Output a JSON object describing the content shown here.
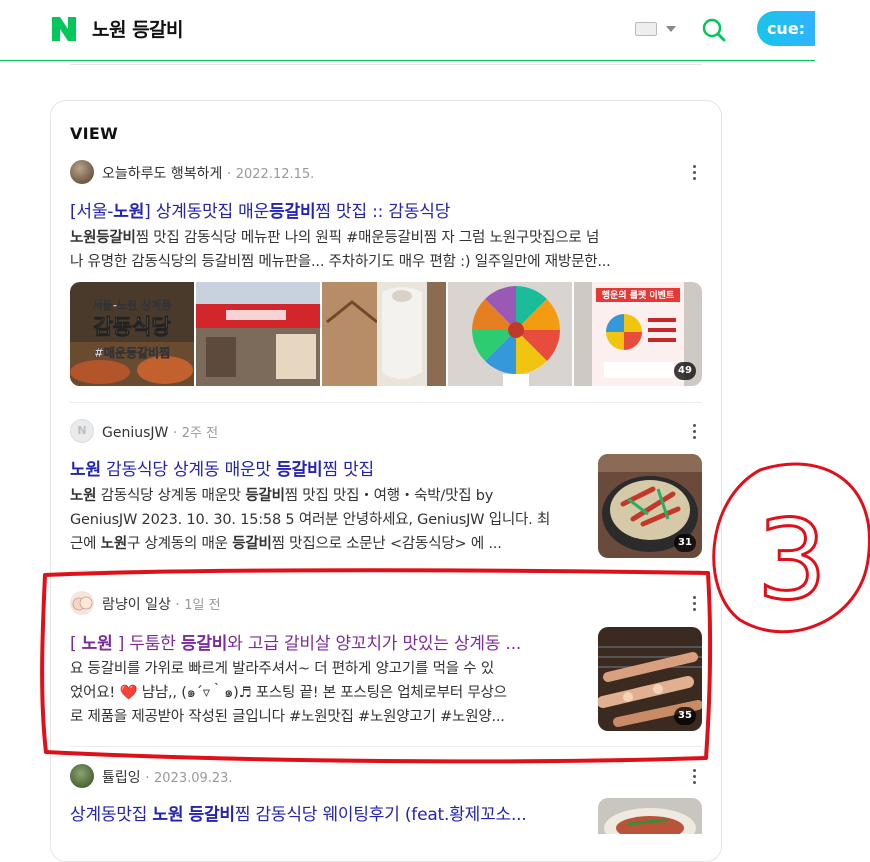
{
  "header": {
    "query": "노원 등갈비",
    "cue_label": "cue:"
  },
  "section": {
    "title": "VIEW"
  },
  "posts": [
    {
      "author": "오늘하루도 행복하게",
      "date": "2022.12.15.",
      "title_parts": [
        "[서울-",
        "노원",
        "] 상계동맛집 매운",
        "등갈비",
        "찜 맛집 :: 감동식당"
      ],
      "desc_line1_parts": [
        "노원등갈비",
        "찜 맛집 감동식당 메뉴판 나의 원픽 #매운등갈비찜 자 그럼 노원구맛집으로 넘"
      ],
      "desc_line2": "나 유명한 감동식당의 등갈비찜 메뉴판을... 주차하기도 매우 편함 :) 일주일만에 재방문한...",
      "thumb1_lines": [
        "서울-노원 상계동",
        "감동식당",
        "#매운등갈비찜"
      ],
      "thumb6_sign": "행운의 룰렛 이벤트",
      "image_count": "49"
    },
    {
      "author": "GeniusJW",
      "date": "2주 전",
      "title_parts": [
        "노원",
        " 감동식당 상계동 매운맛 ",
        "등갈비",
        "찜 맛집"
      ],
      "desc_line1_parts": [
        "노원",
        " 감동식당 상계동 매운맛 ",
        "등갈비",
        "찜 맛집 맛집・여행・숙박/맛집 by"
      ],
      "desc_line2": "GeniusJW 2023. 10. 30. 15:58 5 여러분 안녕하세요, GeniusJW 입니다. 최",
      "desc_line3_parts": [
        "근에 ",
        "노원",
        "구 상계동의 매운 ",
        "등갈비",
        "찜 맛집으로 소문난 <감동식당> 에 ..."
      ],
      "image_count": "31"
    },
    {
      "author": "람냥이 일상",
      "date": "1일 전",
      "title_parts": [
        "[ ",
        "노원",
        " ] 두툼한 ",
        "등갈비",
        "와 고급 갈비살 양꼬치가 맛있는 상계동 ..."
      ],
      "desc_line1": "요 등갈비를 가위로 빠르게 발라주셔서~ 더 편하게 양고기를 먹을 수 있",
      "desc_line2": "었어요! ❤️ 냠냠,, (๑´▿｀๑)♬ 포스팅 끝! 본 포스팅은 업체로부터 무상으",
      "desc_line3": "로 제품을 제공받아 작성된 글입니다 #노원맛집 #노원양고기 #노원양...",
      "image_count": "35"
    },
    {
      "author": "튤립잉",
      "date": "2023.09.23.",
      "title_parts": [
        "상계동맛집 ",
        "노원",
        " ",
        "등갈비",
        "찜 감동식당 웨이팅후기 (feat.황제꼬소..."
      ]
    }
  ],
  "annotation": {
    "number": "3",
    "color": "#e0101a"
  },
  "colors": {
    "brand": "#03c75a",
    "link": "#2323b4",
    "visited": "#7c2c9a"
  }
}
